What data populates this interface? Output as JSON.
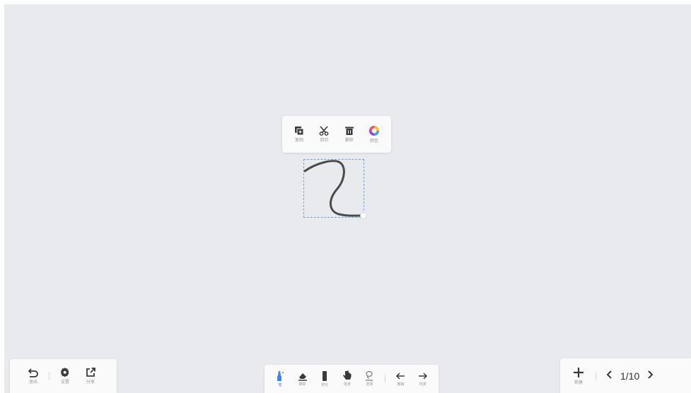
{
  "context_menu": {
    "copy_label": "复制",
    "cut_label": "剪切",
    "delete_label": "删除",
    "color_label": "颜色"
  },
  "left_toolbar": {
    "exit_label": "退出",
    "settings_label": "设置",
    "share_label": "分享"
  },
  "center_toolbar": {
    "pen_label": "笔",
    "eraser_label": "擦除",
    "marker_label": "荧光",
    "hand_label": "漫游",
    "select_label": "选择",
    "undo_label": "撤销",
    "redo_label": "恢复"
  },
  "right_toolbar": {
    "new_label": "新建",
    "page_indicator": "1/10"
  },
  "colors": {
    "canvas_bg": "#e9eaed",
    "panel_bg": "#fafafa",
    "accent": "#3b86f0",
    "icon": "#3a3a3a",
    "selection_border": "#6fa3e6"
  }
}
